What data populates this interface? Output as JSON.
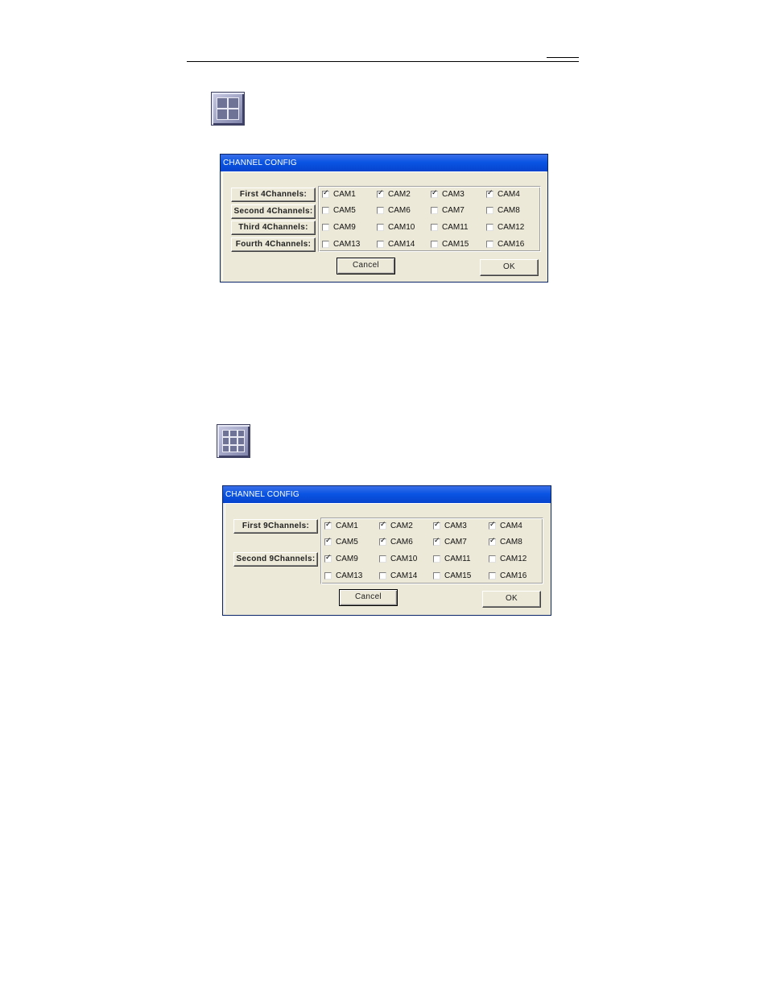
{
  "dialog1": {
    "title": "CHANNEL CONFIG",
    "group_buttons": [
      "First 4Channels:",
      "Second 4Channels:",
      "Third 4Channels:",
      "Fourth 4Channels:"
    ],
    "cams": [
      {
        "label": "CAM1",
        "checked": true
      },
      {
        "label": "CAM2",
        "checked": true
      },
      {
        "label": "CAM3",
        "checked": true
      },
      {
        "label": "CAM4",
        "checked": true
      },
      {
        "label": "CAM5",
        "checked": false
      },
      {
        "label": "CAM6",
        "checked": false
      },
      {
        "label": "CAM7",
        "checked": false
      },
      {
        "label": "CAM8",
        "checked": false
      },
      {
        "label": "CAM9",
        "checked": false
      },
      {
        "label": "CAM10",
        "checked": false
      },
      {
        "label": "CAM11",
        "checked": false
      },
      {
        "label": "CAM12",
        "checked": false
      },
      {
        "label": "CAM13",
        "checked": false
      },
      {
        "label": "CAM14",
        "checked": false
      },
      {
        "label": "CAM15",
        "checked": false
      },
      {
        "label": "CAM16",
        "checked": false
      }
    ],
    "cancel_label": "Cancel",
    "ok_label": "OK"
  },
  "dialog2": {
    "title": "CHANNEL CONFIG",
    "group_buttons": [
      "First 9Channels:",
      "Second 9Channels:"
    ],
    "cams": [
      {
        "label": "CAM1",
        "checked": true
      },
      {
        "label": "CAM2",
        "checked": true
      },
      {
        "label": "CAM3",
        "checked": true
      },
      {
        "label": "CAM4",
        "checked": true
      },
      {
        "label": "CAM5",
        "checked": true
      },
      {
        "label": "CAM6",
        "checked": true
      },
      {
        "label": "CAM7",
        "checked": true
      },
      {
        "label": "CAM8",
        "checked": true
      },
      {
        "label": "CAM9",
        "checked": true
      },
      {
        "label": "CAM10",
        "checked": false
      },
      {
        "label": "CAM11",
        "checked": false
      },
      {
        "label": "CAM12",
        "checked": false
      },
      {
        "label": "CAM13",
        "checked": false
      },
      {
        "label": "CAM14",
        "checked": false
      },
      {
        "label": "CAM15",
        "checked": false
      },
      {
        "label": "CAM16",
        "checked": false
      }
    ],
    "cancel_label": "Cancel",
    "ok_label": "OK"
  },
  "icons": {
    "layout_4": "quad-layout-icon",
    "layout_9": "nine-grid-layout-icon",
    "checkmark": "✓"
  },
  "colors": {
    "titlebar": "#0a55e4",
    "dialog_bg": "#ece9d8"
  }
}
